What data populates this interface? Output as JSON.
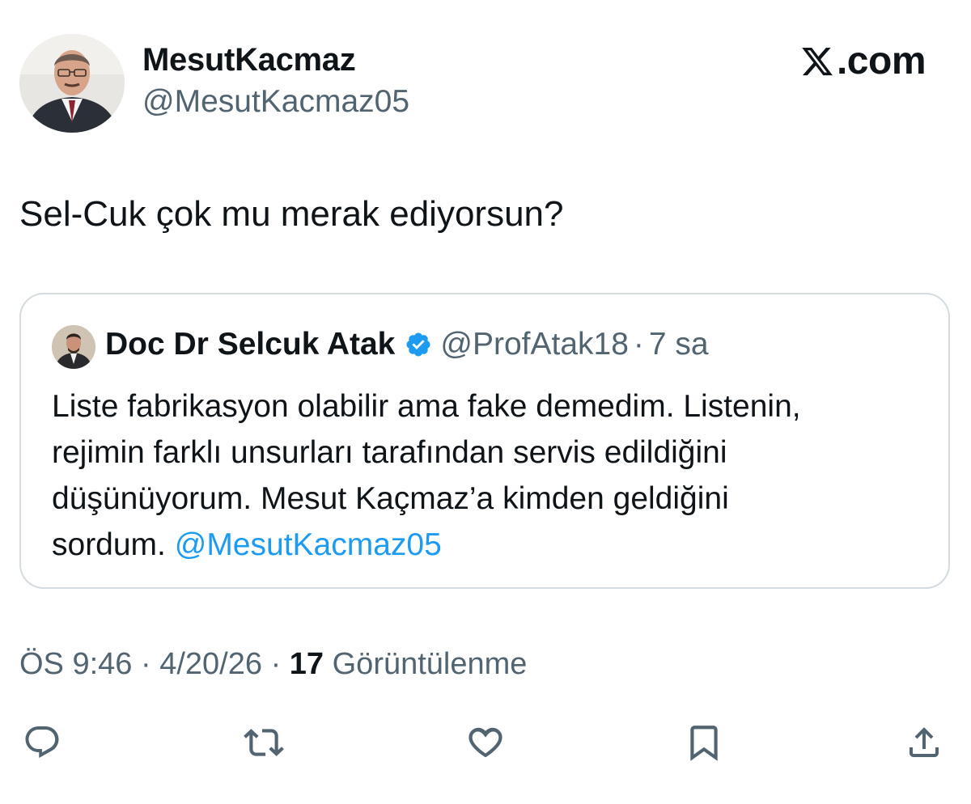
{
  "post": {
    "author_name": "MesutKacmaz",
    "author_handle": "@MesutKacmaz05",
    "brand": ".com",
    "text": "Sel-Cuk çok mu merak ediyorsun?"
  },
  "quote": {
    "author_name": "Doc Dr Selcuk Atak",
    "verified": true,
    "author_handle": "@ProfAtak18",
    "separator": "·",
    "time_ago": "7 sa",
    "lines": [
      "Liste fabrikasyon olabilir ama fake demedim. Listenin,",
      "rejimin farklı unsurları tarafından servis edildiğini",
      "düşünüyorum. Mesut Kaçmaz’a kimden geldiğini",
      "sordum."
    ],
    "mention": "@MesutKacmaz05"
  },
  "meta": {
    "time": "ÖS 9:46",
    "sep1": "·",
    "date": "4/20/26",
    "sep2": "·",
    "views_count": "17",
    "views_label": "Görüntülenme"
  },
  "actions": [
    "reply-icon",
    "repost-icon",
    "like-icon",
    "bookmark-icon",
    "share-icon"
  ],
  "colors": {
    "text": "#0f1419",
    "secondary": "#536471",
    "link": "#1d9bf0",
    "border": "#d4dbe1",
    "verified": "#1d9bf0"
  }
}
